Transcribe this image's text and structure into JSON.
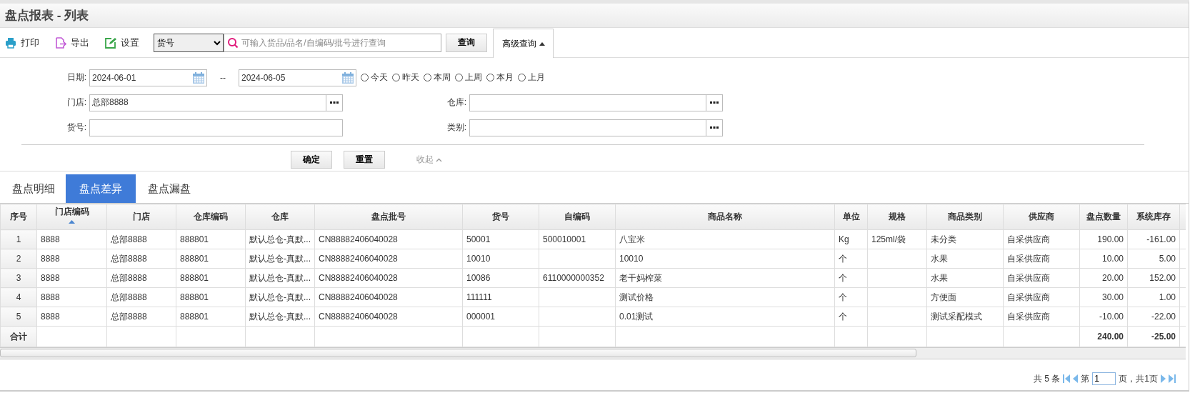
{
  "window": {
    "title": "盘点报表 - 列表"
  },
  "toolbar": {
    "actions": [
      {
        "kind": "print",
        "label": "打印"
      },
      {
        "kind": "export",
        "label": "导出"
      },
      {
        "kind": "settings",
        "label": "设置"
      }
    ],
    "field_select": "货号",
    "search": {
      "placeholder": "可输入货品/品名/自编码/批号进行查询"
    },
    "query_button": "查询",
    "advanced_button": {
      "label": "高级查询",
      "expanded": true
    }
  },
  "filters": {
    "date_label": "日期:",
    "date_from": "2024-06-01",
    "date_sep": "--",
    "date_to": "2024-06-05",
    "quick_ranges": [
      {
        "label": "今天",
        "selected": false
      },
      {
        "label": "昨天",
        "selected": false
      },
      {
        "label": "本周",
        "selected": false
      },
      {
        "label": "上周",
        "selected": false
      },
      {
        "label": "本月",
        "selected": false
      },
      {
        "label": "上月",
        "selected": false
      }
    ],
    "store_label": "门店:",
    "store_value": "总部8888",
    "warehouse_label": "仓库:",
    "item_no_label": "货号:",
    "category_label": "类别:",
    "confirm_button": "确定",
    "reset_button": "重置",
    "collapse_link": "收起"
  },
  "tabs": [
    {
      "label": "盘点明细",
      "selected": false
    },
    {
      "label": "盘点差异",
      "selected": true
    },
    {
      "label": "盘点漏盘",
      "selected": false
    }
  ],
  "table": {
    "columns": [
      "序号",
      "门店编码",
      "门店",
      "仓库编码",
      "仓库",
      "盘点批号",
      "货号",
      "自编码",
      "商品名称",
      "单位",
      "规格",
      "商品类别",
      "供应商",
      "盘点数量",
      "系统库存"
    ],
    "rows": [
      [
        "1",
        "8888",
        "总部8888",
        "888801",
        "默认总仓-真默...",
        "CN88882406040028",
        "50001",
        "500010001",
        "八宝米",
        "Kg",
        "125ml/袋",
        "未分类",
        "自采供应商",
        "190.00",
        "-161.00"
      ],
      [
        "2",
        "8888",
        "总部8888",
        "888801",
        "默认总仓-真默...",
        "CN88882406040028",
        "10010",
        "",
        "10010",
        "个",
        "",
        "水果",
        "自采供应商",
        "10.00",
        "5.00"
      ],
      [
        "3",
        "8888",
        "总部8888",
        "888801",
        "默认总仓-真默...",
        "CN88882406040028",
        "10086",
        "6110000000352",
        "老干妈榨菜",
        "个",
        "",
        "水果",
        "自采供应商",
        "20.00",
        "152.00"
      ],
      [
        "4",
        "8888",
        "总部8888",
        "888801",
        "默认总仓-真默...",
        "CN88882406040028",
        "111111",
        "",
        "测试价格",
        "个",
        "",
        "方便面",
        "自采供应商",
        "30.00",
        "1.00"
      ],
      [
        "5",
        "8888",
        "总部8888",
        "888801",
        "默认总仓-真默...",
        "CN88882406040028",
        "000001",
        "",
        "0.01测试",
        "个",
        "",
        "测试采配模式",
        "自采供应商",
        "-10.00",
        "-22.00"
      ]
    ],
    "total_row": {
      "label": "合计",
      "count_total": "240.00",
      "stock_total": "-25.00"
    }
  },
  "pager": {
    "total": "共 5 条",
    "page_prefix": "第",
    "page": "1",
    "page_suffix": "页，共1页"
  }
}
